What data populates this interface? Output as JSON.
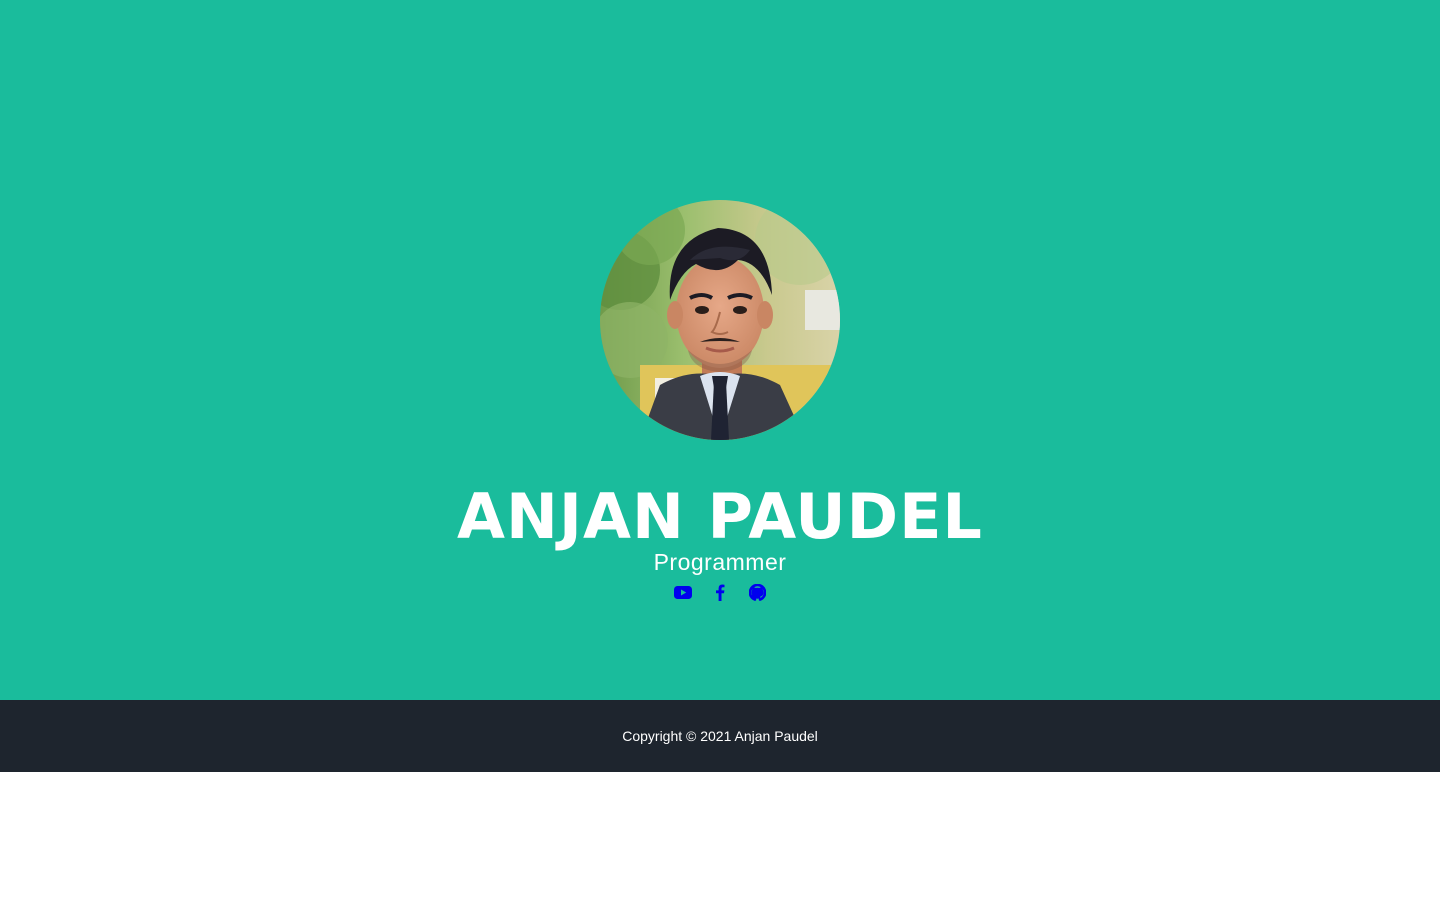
{
  "profile": {
    "name": "ANJAN PAUDEL",
    "title": "Programmer"
  },
  "social": [
    {
      "icon": "youtube-icon",
      "label": "YouTube"
    },
    {
      "icon": "facebook-icon",
      "label": "Facebook"
    },
    {
      "icon": "github-icon",
      "label": "GitHub"
    }
  ],
  "footer": {
    "copyright": "Copyright © 2021 Anjan Paudel"
  },
  "colors": {
    "masthead_bg": "#1abc9c",
    "footer_bg": "#1e252e",
    "icon_color": "#0000ee",
    "text": "#ffffff"
  }
}
